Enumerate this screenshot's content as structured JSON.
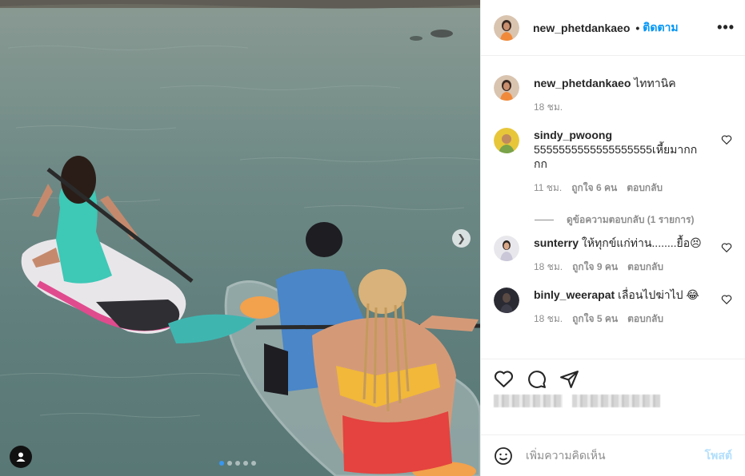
{
  "post": {
    "username": "new_phetdankaeo",
    "follow_label": "ติดตาม",
    "more_label": "•••"
  },
  "caption": {
    "username": "new_phetdankaeo",
    "text": "ไททานิค",
    "time": "18 ชม."
  },
  "comments": [
    {
      "username": "sindy_pwoong",
      "text": "5555555555555555555เหี้ยมากกกก",
      "time": "11 ชม.",
      "likes": "ถูกใจ 6 คน",
      "reply": "ตอบกลับ"
    },
    {
      "username": "sunterry",
      "text": "ให้ทุกข์แก่ท่าน........ยื้อ😣",
      "time": "18 ชม.",
      "likes": "ถูกใจ 9 คน",
      "reply": "ตอบกลับ"
    },
    {
      "username": "binly_weerapat",
      "text": "เลื่อนไปฆ่าไป 😂",
      "time": "18 ชม.",
      "likes": "ถูกใจ 5 คน",
      "reply": "ตอบกลับ"
    }
  ],
  "view_replies": "ดูข้อความตอบกลับ (1 รายการ)",
  "add_comment": {
    "placeholder": "เพิ่มความคิดเห็น",
    "post_label": "โพสต์"
  },
  "carousel": {
    "total": 5,
    "active": 1
  },
  "icons": {
    "like": "heart-icon",
    "comment": "comment-icon",
    "share": "paper-plane-icon",
    "emoji": "smiley-icon",
    "next": "chevron-right-icon",
    "tag": "user-tag-icon"
  },
  "colors": {
    "accent": "#0095f6",
    "muted": "#8e8e8e",
    "post_disabled": "#b2dffc"
  }
}
